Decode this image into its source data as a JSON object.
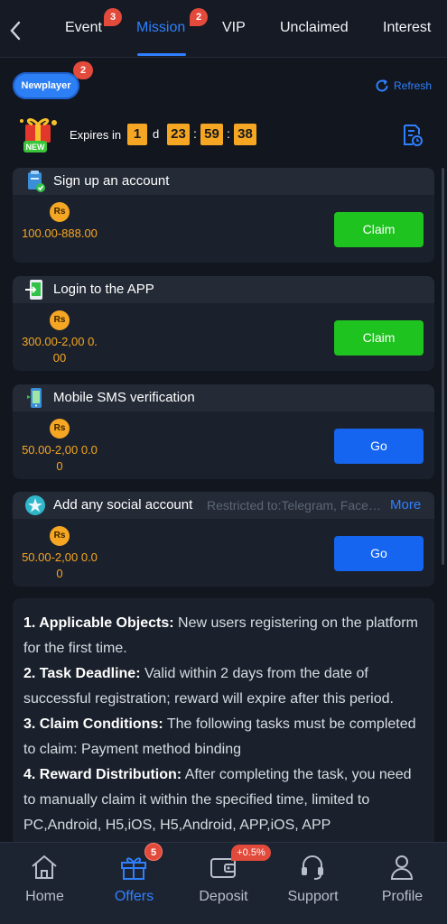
{
  "tabs": [
    {
      "label": "Event",
      "badge": "3"
    },
    {
      "label": "Mission",
      "badge": "2",
      "active": true
    },
    {
      "label": "VIP"
    },
    {
      "label": "Unclaimed"
    },
    {
      "label": "Interest"
    }
  ],
  "subheader": {
    "newplayer_label": "Newplayer",
    "newplayer_badge": "2",
    "refresh_label": "Refresh"
  },
  "countdown": {
    "new_tag": "NEW",
    "label": "Expires in",
    "days": "1",
    "day_unit": "d",
    "hours": "23",
    "minutes": "59",
    "seconds": "38",
    "sep": ":"
  },
  "tasks": [
    {
      "title": "Sign up an account",
      "currency": "Rs",
      "reward": "100.00-888.00",
      "button": "Claim",
      "icon": "clipboard-check-icon"
    },
    {
      "title": "Login to the APP",
      "currency": "Rs",
      "reward": "300.00-2,00 0.00",
      "button": "Claim",
      "icon": "app-login-icon"
    },
    {
      "title": "Mobile SMS verification",
      "currency": "Rs",
      "reward": "50.00-2,00 0.00",
      "button": "Go",
      "icon": "phone-icon"
    },
    {
      "title": "Add any social account",
      "restriction": "Restricted to:Telegram, Facebook",
      "more": "More",
      "currency": "Rs",
      "reward": "50.00-2,00 0.00",
      "button": "Go",
      "icon": "social-star-icon"
    }
  ],
  "rules": [
    {
      "head": "1. Applicable Objects:",
      "text": " New users registering on the platform for the first time."
    },
    {
      "head": "2. Task Deadline:",
      "text": " Valid within 2 days from the date of successful registration; reward will expire after this period."
    },
    {
      "head": "3. Claim Conditions:",
      "text": " The following tasks must be completed to claim: Payment method binding"
    },
    {
      "head": "4. Reward Distribution:",
      "text": " After completing the task, you need to manually claim it within the specified time, limited to PC,Android, H5,iOS, H5,Android, APP,iOS, APP"
    }
  ],
  "nav": [
    {
      "label": "Home",
      "icon": "home-icon"
    },
    {
      "label": "Offers",
      "icon": "gift-icon",
      "badge": "5",
      "active": true
    },
    {
      "label": "Deposit",
      "icon": "wallet-icon",
      "badge": "+0.5%"
    },
    {
      "label": "Support",
      "icon": "headset-icon"
    },
    {
      "label": "Profile",
      "icon": "profile-icon"
    }
  ],
  "colors": {
    "accent": "#2f80ff",
    "claim": "#1fc31f",
    "go": "#1565f0",
    "gold": "#f5a623",
    "badge": "#e24a3b"
  }
}
